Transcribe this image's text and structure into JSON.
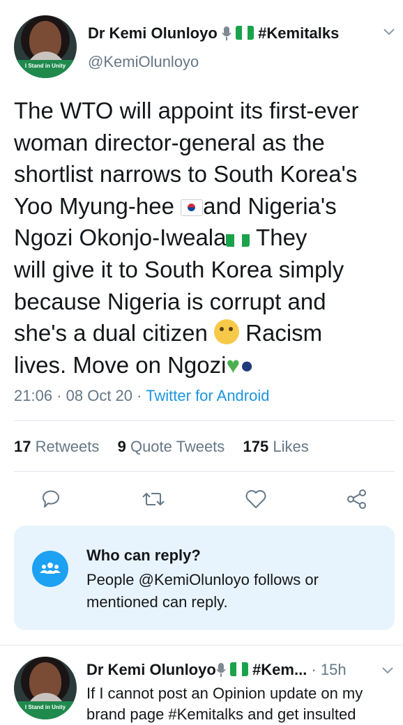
{
  "tweet": {
    "display_name": "Dr Kemi Olunloyo",
    "name_hashtag": "#Kemitalks",
    "handle": "@KemiOlunloyo",
    "avatar_banner": "I Stand in Unity",
    "text_lines": [
      "The WTO will appoint its first-ever",
      "woman director-general as the",
      "shortlist narrows to South Korea's",
      "Yoo Myung-hee ",
      "and Nigeria's",
      "Ngozi Okonjo-Iweala",
      " They",
      "will give it to South Korea simply",
      "because Nigeria is corrupt and",
      "she's a dual citizen ",
      " Racism",
      "lives. Move on Ngozi"
    ],
    "time": "21:06",
    "date": "08 Oct 20",
    "source": "Twitter for Android",
    "retweets_count": "17",
    "retweets_label": "Retweets",
    "quotes_count": "9",
    "quotes_label": "Quote Tweets",
    "likes_count": "175",
    "likes_label": "Likes"
  },
  "reply_settings": {
    "title": "Who can reply?",
    "body": "People @KemiOlunloyo follows or mentioned can reply."
  },
  "next_tweet": {
    "display_name": "Dr Kemi Olunloyo",
    "name_suffix": "#Kem...",
    "time_ago": "15h",
    "text_line1": "If I cannot post an Opinion update on my",
    "text_line2": "brand page #Kemitalks and get insulted",
    "avatar_banner": "I Stand in Unity"
  },
  "colors": {
    "accent": "#1da1f2",
    "link": "#1b95e0",
    "muted": "#657786",
    "reply_bg": "#e8f4fd"
  }
}
